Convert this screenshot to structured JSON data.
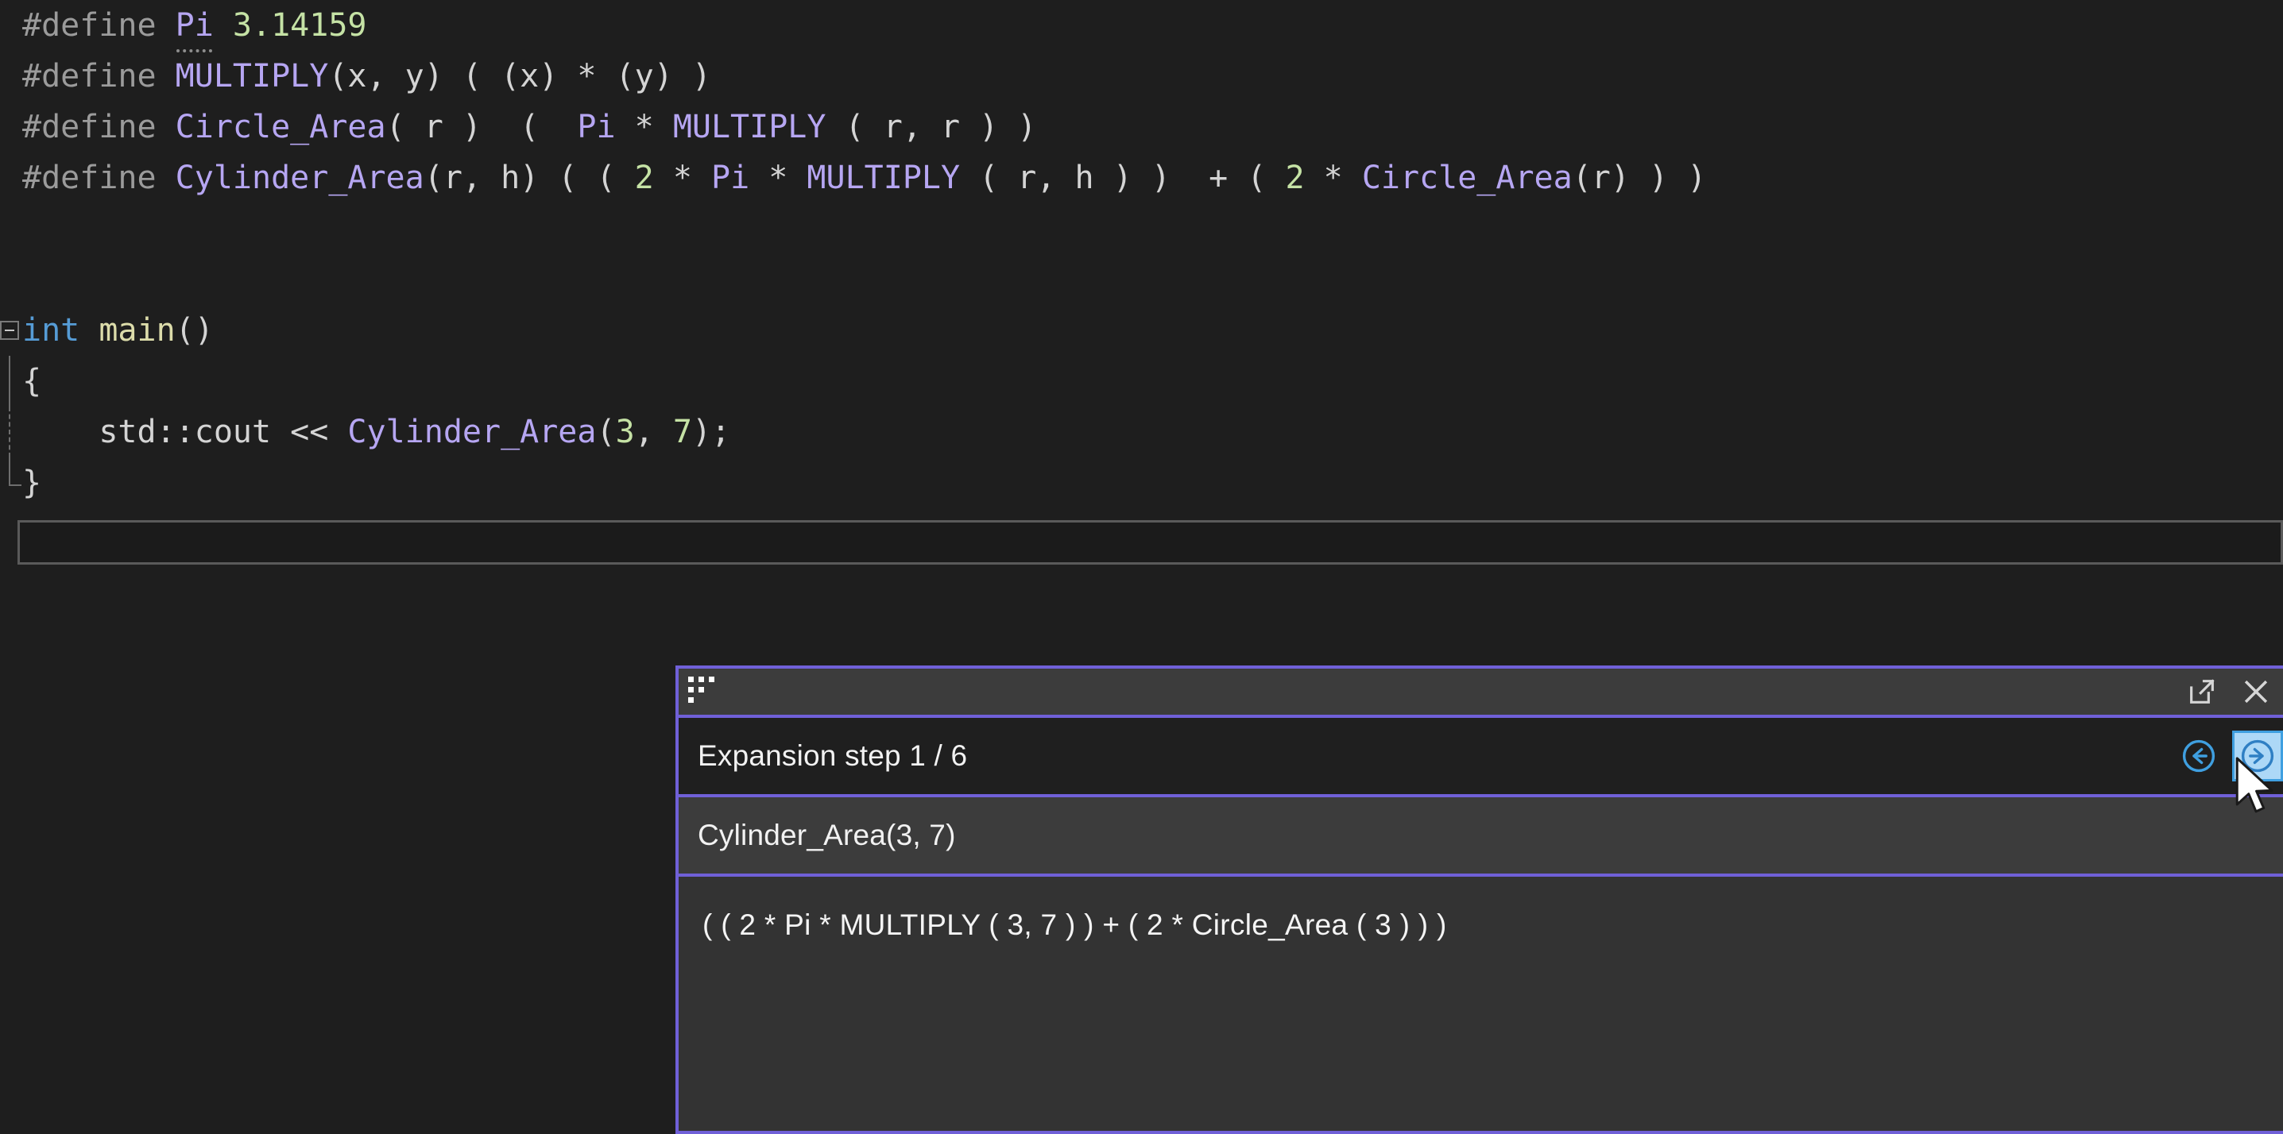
{
  "editor": {
    "name": "code-editor",
    "background": "#1e1e1e",
    "lines": [
      {
        "id": "define-pi",
        "tokens": [
          {
            "t": "#define ",
            "c": "c-dir"
          },
          {
            "t": "Pi",
            "c": "c-macro sugg"
          },
          {
            "t": " ",
            "c": "c-plain"
          },
          {
            "t": "3.14159",
            "c": "c-num"
          }
        ]
      },
      {
        "id": "define-multiply",
        "tokens": [
          {
            "t": "#define ",
            "c": "c-dir"
          },
          {
            "t": "MULTIPLY",
            "c": "c-macro"
          },
          {
            "t": "(x, y) ( (x) * (y) )",
            "c": "c-plain"
          }
        ]
      },
      {
        "id": "define-circle-area",
        "tokens": [
          {
            "t": "#define ",
            "c": "c-dir"
          },
          {
            "t": "Circle_Area",
            "c": "c-macro"
          },
          {
            "t": "( r )  (  ",
            "c": "c-plain"
          },
          {
            "t": "Pi",
            "c": "c-macro"
          },
          {
            "t": " * ",
            "c": "c-plain"
          },
          {
            "t": "MULTIPLY",
            "c": "c-macro"
          },
          {
            "t": " ( r, r ) )",
            "c": "c-plain"
          }
        ]
      },
      {
        "id": "define-cylinder-area",
        "tokens": [
          {
            "t": "#define ",
            "c": "c-dir"
          },
          {
            "t": "Cylinder_Area",
            "c": "c-macro"
          },
          {
            "t": "(r, h) ( ( ",
            "c": "c-plain"
          },
          {
            "t": "2",
            "c": "c-num"
          },
          {
            "t": " * ",
            "c": "c-plain"
          },
          {
            "t": "Pi",
            "c": "c-macro"
          },
          {
            "t": " * ",
            "c": "c-plain"
          },
          {
            "t": "MULTIPLY",
            "c": "c-macro"
          },
          {
            "t": " ( r, h ) )  + ( ",
            "c": "c-plain"
          },
          {
            "t": "2",
            "c": "c-num"
          },
          {
            "t": " * ",
            "c": "c-plain"
          },
          {
            "t": "Circle_Area",
            "c": "c-macro"
          },
          {
            "t": "(r) ) )",
            "c": "c-plain"
          }
        ]
      },
      {
        "id": "blank-1",
        "tokens": []
      },
      {
        "id": "blank-2",
        "tokens": []
      },
      {
        "id": "main-signature",
        "gutter": "fold",
        "tokens": [
          {
            "t": "int",
            "c": "c-kw"
          },
          {
            "t": " ",
            "c": "c-plain"
          },
          {
            "t": "main",
            "c": "c-fn"
          },
          {
            "t": "()",
            "c": "c-plain"
          }
        ]
      },
      {
        "id": "open-brace",
        "gutter": "line",
        "tokens": [
          {
            "t": "{",
            "c": "c-brace"
          }
        ]
      },
      {
        "id": "cout-statement",
        "gutter": "dash",
        "tokens": [
          {
            "t": "    ",
            "c": "c-plain"
          },
          {
            "t": "std::cout",
            "c": "c-id"
          },
          {
            "t": " << ",
            "c": "c-plain"
          },
          {
            "t": "Cylinder_Area",
            "c": "c-macro"
          },
          {
            "t": "(",
            "c": "c-plain"
          },
          {
            "t": "3",
            "c": "c-num"
          },
          {
            "t": ", ",
            "c": "c-plain"
          },
          {
            "t": "7",
            "c": "c-num"
          },
          {
            "t": ");",
            "c": "c-plain"
          }
        ]
      },
      {
        "id": "close-brace",
        "gutter": "end",
        "tokens": [
          {
            "t": "}",
            "c": "c-brace"
          }
        ]
      }
    ]
  },
  "inline_strip": {
    "label": ""
  },
  "macro_panel": {
    "accent_color": "#7060d8",
    "titlebar_background": "#3c3c3c",
    "panel_background": "#333333",
    "grip_icon": "drag-grip-icon",
    "buttons": {
      "popout_icon": "open-in-new-window-icon",
      "popout_label": "Open in new window",
      "close_icon": "close-icon",
      "close_label": "Close"
    },
    "step": {
      "label": "Expansion step 1 / 6",
      "current": 1,
      "total": 6,
      "back_icon": "arrow-left-circle-icon",
      "back_label": "Previous expansion step",
      "forward_icon": "arrow-right-circle-icon",
      "forward_label": "Next expansion step",
      "forward_hover_color": "#add8f7"
    },
    "macro": {
      "label": "Cylinder_Area(3, 7)"
    },
    "expansion": {
      "text": "( ( 2 * Pi * MULTIPLY ( 3, 7 ) ) + ( 2 * Circle_Area ( 3 ) ) )"
    }
  },
  "cursor": {
    "icon": "mouse-pointer-icon"
  }
}
